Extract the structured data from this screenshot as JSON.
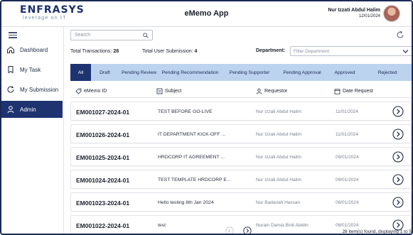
{
  "header": {
    "logo_main": "ENFRASYS",
    "logo_tagline": "leverage on IT",
    "app_title": "eMemo App",
    "user_name": "Nur Izzati Abdul Halim",
    "user_date": "12/01/2024"
  },
  "sidebar": {
    "items": [
      {
        "label": "Dashboard",
        "icon": "home-icon"
      },
      {
        "label": "My Task",
        "icon": "bookmark-icon"
      },
      {
        "label": "My Submission",
        "icon": "refresh-icon"
      },
      {
        "label": "Admin",
        "icon": "user-icon"
      }
    ],
    "active_index": 3
  },
  "toolbar": {
    "search_placeholder": "Search",
    "total_transactions_label": "Total Transactions:",
    "total_transactions_value": "28",
    "total_user_submission_label": "Total User Submission:",
    "total_user_submission_value": "4",
    "department_label": "Department:",
    "department_placeholder": "Filter Department"
  },
  "tabs": [
    {
      "label": "All",
      "width": 29
    },
    {
      "label": "Draft",
      "width": 39
    },
    {
      "label": "Pending Review",
      "width": 57
    },
    {
      "label": "Pending Recommendation",
      "width": 87
    },
    {
      "label": "Pending Supporter",
      "width": 80
    },
    {
      "label": "Pending Approval",
      "width": 68
    },
    {
      "label": "Approved",
      "width": 52
    },
    {
      "label": "Rejected",
      "width": 68
    }
  ],
  "active_tab": 0,
  "columns": {
    "id": "eMemo ID",
    "subject": "Subject",
    "requestor": "Requestor",
    "date": "Date Request"
  },
  "rows": [
    {
      "id": "EM001027-2024-01",
      "subject": "TEST BEFORE GO-LIVE",
      "requestor": "Nur Izzati Abdul Halim",
      "date": "11/01/2024"
    },
    {
      "id": "EM001026-2024-01",
      "subject": "IT DEPARTMENT KICK-OFF ...",
      "requestor": "Nur Izzati Abdul Halim",
      "date": "11/01/2024"
    },
    {
      "id": "EM001025-2024-01",
      "subject": "HRDCORP IT AGREEMENT ...",
      "requestor": "Nur Izzati Abdul Halim",
      "date": "09/01/2024"
    },
    {
      "id": "EM001024-2024-01",
      "subject": "TEST TEMPLATE HRDCORP E...",
      "requestor": "Nur Izzati Abdul Halim",
      "date": "09/01/2024"
    },
    {
      "id": "EM001023-2024-01",
      "subject": "Hello testing 8th Jan 2024",
      "requestor": "Nur Badariah Hassan",
      "date": "08/01/2024"
    },
    {
      "id": "EM001022-2024-01",
      "subject": "test",
      "requestor": "Nurain Damia Binti Abidin",
      "date": "08/01/2024"
    }
  ],
  "footer": {
    "found_text": "28 item(s) found, displaying 1 to 5"
  },
  "colors": {
    "primary": "#1e3370",
    "tab_bg": "#bcd3ef",
    "border": "#e1e4ea"
  }
}
